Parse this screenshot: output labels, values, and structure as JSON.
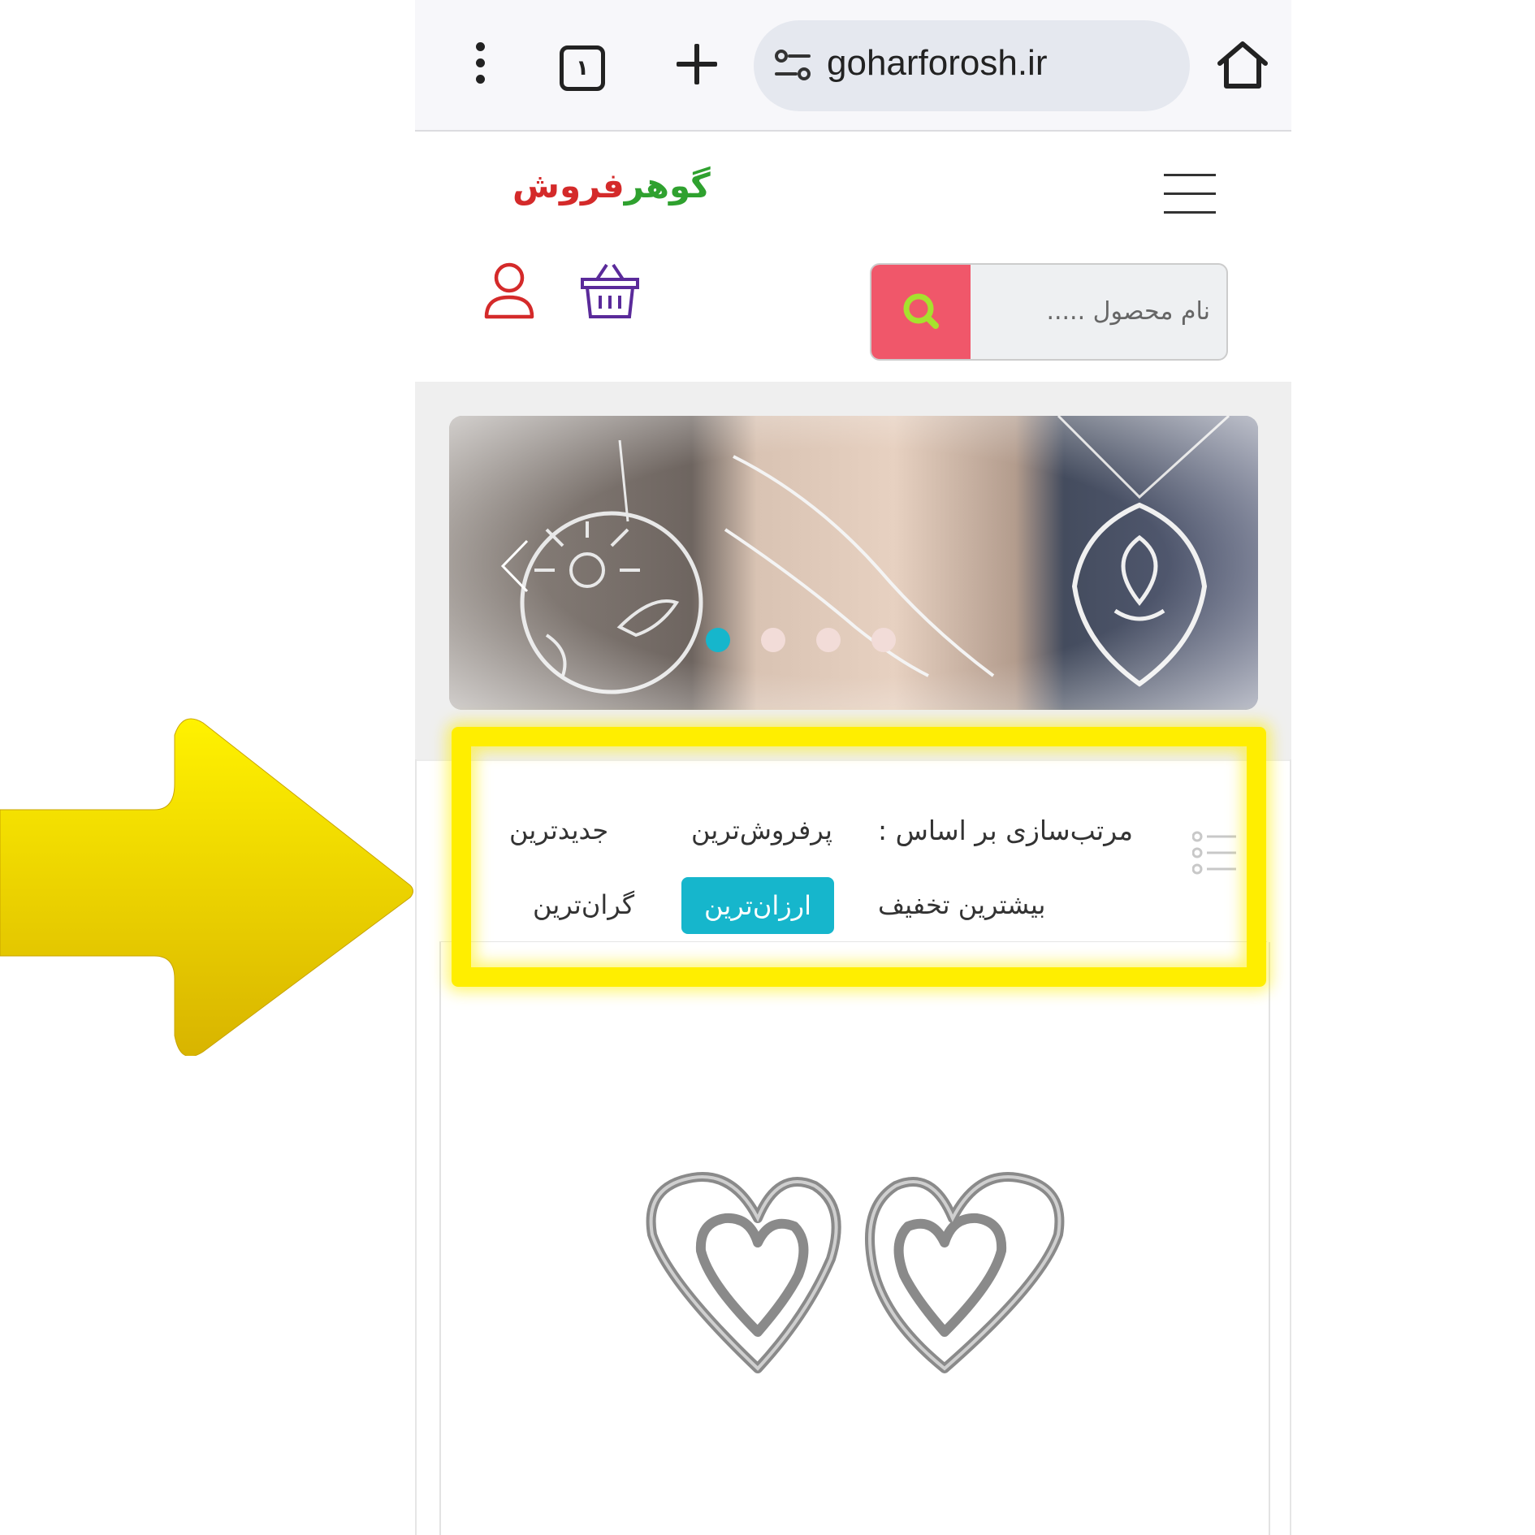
{
  "browser": {
    "tab_count": "١",
    "url": "goharforosh.ir",
    "icons": [
      "more-vert-icon",
      "tabs-icon",
      "new-tab-icon",
      "site-settings-icon",
      "home-icon"
    ]
  },
  "header": {
    "logo_part1": "گوهر",
    "logo_part2": "فروش",
    "search_placeholder": "نام محصول .....",
    "icons": [
      "hamburger-icon",
      "search-icon",
      "user-icon",
      "basket-icon"
    ]
  },
  "slider": {
    "slide_count": 4,
    "active_index": 0
  },
  "sort": {
    "label": "مرتب‌سازی بر اساس :",
    "options": [
      "پرفروش‌ترین",
      "جدیدترین",
      "بیشترین تخفیف",
      "ارزان‌ترین",
      "گران‌ترین"
    ],
    "active": "ارزان‌ترین"
  },
  "colors": {
    "accent": "#16b6cc",
    "search_button": "#f0576a",
    "logo_green": "#2fa12f",
    "logo_red": "#d42a2a",
    "highlight": "#ffee00",
    "basket": "#5a2a9a",
    "user": "#d42a2a"
  }
}
